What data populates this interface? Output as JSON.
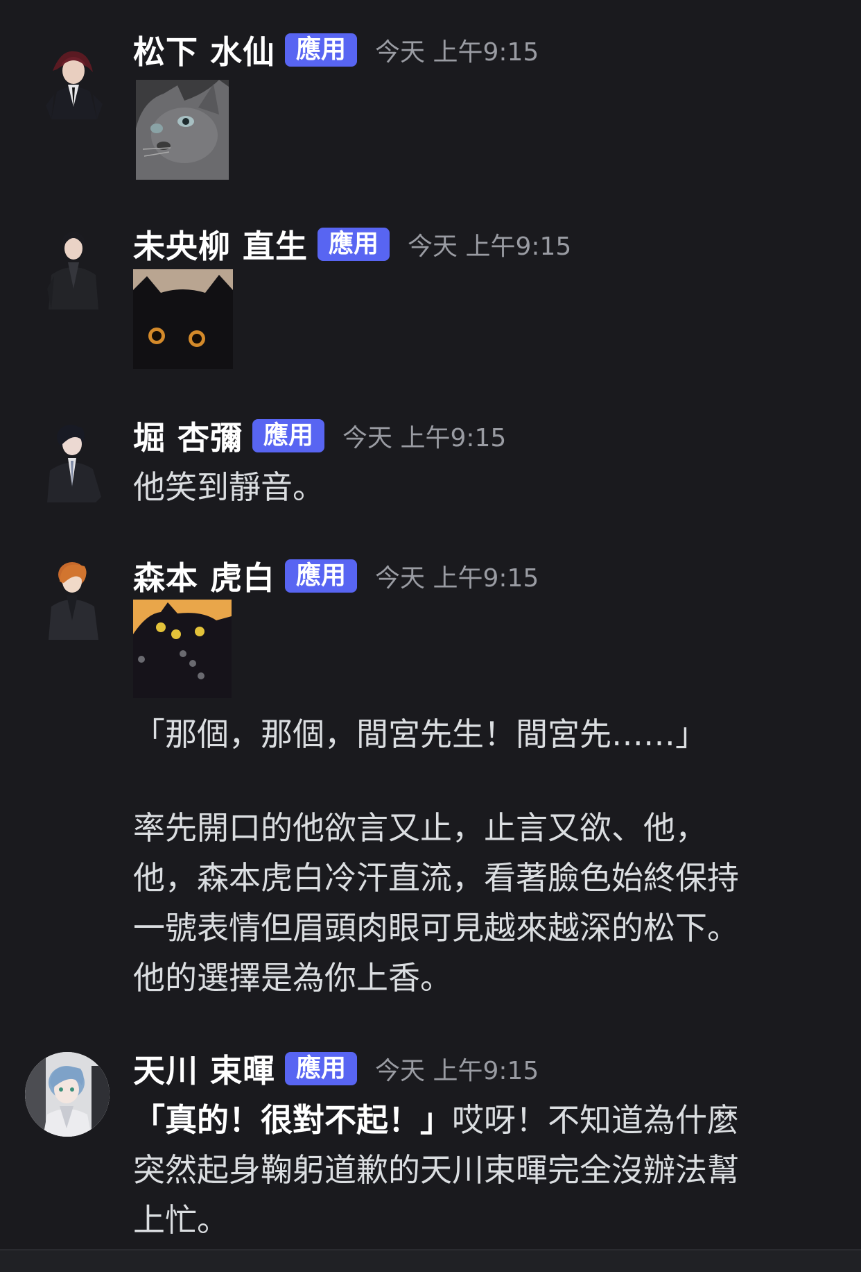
{
  "messages": [
    {
      "author": "松下 水仙",
      "badge": "應用",
      "time": "今天 上午9:15",
      "attachment": "cat-photo-gray",
      "avatar": "suited-man-red-hair"
    },
    {
      "author": "未央柳 直生",
      "badge": "應用",
      "time": "今天 上午9:15",
      "attachment": "cat-photo-black",
      "avatar": "man-dark-coat"
    },
    {
      "author": "堀 杏彌",
      "badge": "應用",
      "time": "今天 上午9:15",
      "text": "他笑到靜音。",
      "avatar": "man-dark-hair-tie"
    },
    {
      "author": "森本 虎白",
      "badge": "應用",
      "time": "今天 上午9:15",
      "attachment": "cat-photo-black-orange-bg",
      "avatar": "man-orange-hair",
      "line1": "「那個，那個，間宮先生！間宮先……」",
      "para": "率先開口的他欲言又止，止言又欲、他，\n他，森本虎白冷汗直流，看著臉色始終保持\n一號表情但眉頭肉眼可見越來越深的松下。\n他的選擇是為你上香。"
    },
    {
      "author": "天川 束暉",
      "badge": "應用",
      "time": "今天 上午9:15",
      "avatar": "man-blue-hair-round",
      "bold": "「真的！很對不起！」",
      "rest": "哎呀！不知道為什麼\n突然起身鞠躬道歉的天川束暉完全沒辦法幫\n上忙。"
    }
  ],
  "colors": {
    "background": "#1a1a1e",
    "badge": "#5865f2",
    "timestamp": "#9a9ca3",
    "text": "#dbdee1"
  }
}
